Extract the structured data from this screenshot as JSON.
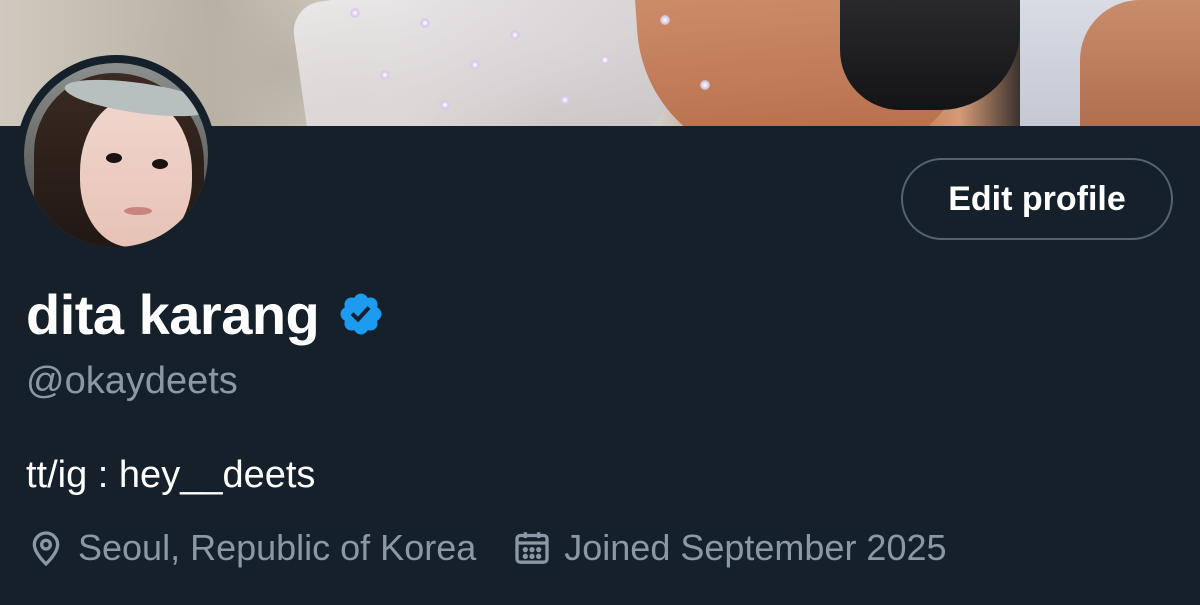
{
  "profile": {
    "display_name": "dita karang",
    "verified": true,
    "handle": "@okaydeets",
    "bio": "tt/ig : hey__deets",
    "location": "Seoul, Republic of Korea",
    "joined": "Joined September 2025"
  },
  "actions": {
    "edit_profile_label": "Edit profile"
  },
  "icons": {
    "verified": "verified-badge-icon",
    "location": "location-pin-icon",
    "joined": "calendar-icon"
  },
  "colors": {
    "background": "#15202b",
    "primary_text": "#ffffff",
    "secondary_text": "#8b98a5",
    "verified_blue": "#1d9bf0",
    "button_border": "#536471"
  }
}
